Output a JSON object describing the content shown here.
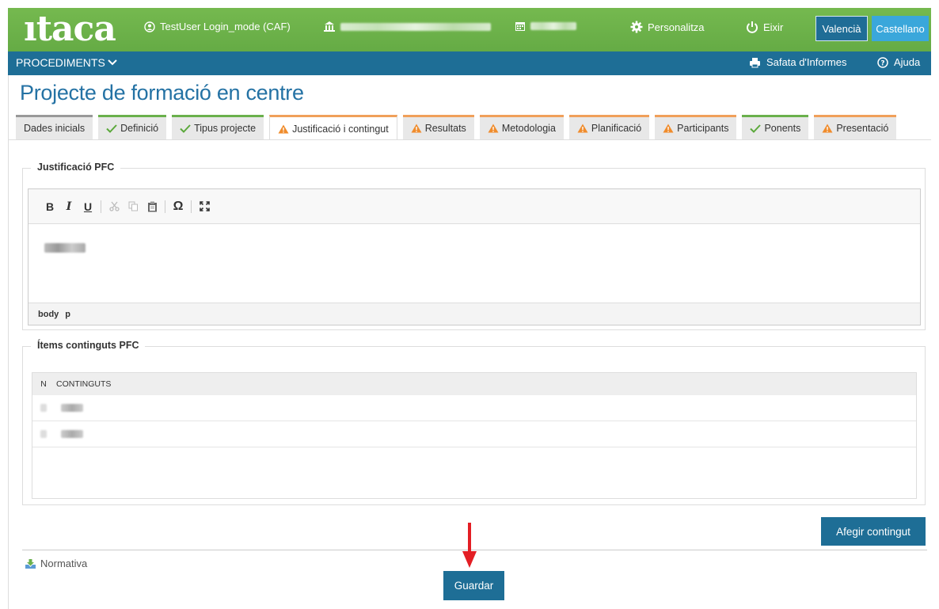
{
  "header": {
    "logo": "ıtaca",
    "user": "TestUser Login_mode (CAF)",
    "personalize": "Personalitza",
    "exit": "Eixir",
    "languages": [
      "Valencià",
      "Castellano"
    ],
    "colors": {
      "header_green": "#6ab04c",
      "nav_blue": "#1e6e96",
      "accent_blue": "#3aa7db",
      "warning_orange": "#f0a05a"
    }
  },
  "nav": {
    "procedures": "PROCEDIMENTS",
    "reports_tray": "Safata d'Informes",
    "help": "Ajuda"
  },
  "page": {
    "title": "Projecte de formació en centre"
  },
  "tabs": [
    {
      "label": "Dades inicials",
      "status": "none"
    },
    {
      "label": "Definició",
      "status": "ok"
    },
    {
      "label": "Tipus projecte",
      "status": "ok"
    },
    {
      "label": "Justificació i contingut",
      "status": "warning",
      "active": true
    },
    {
      "label": "Resultats",
      "status": "warning"
    },
    {
      "label": "Metodologia",
      "status": "warning"
    },
    {
      "label": "Planificació",
      "status": "warning"
    },
    {
      "label": "Participants",
      "status": "warning"
    },
    {
      "label": "Ponents",
      "status": "ok"
    },
    {
      "label": "Presentació",
      "status": "warning"
    }
  ],
  "justification": {
    "legend": "Justificació PFC",
    "toolbar": {
      "bold": "B",
      "italic": "I",
      "underline": "U",
      "special_char": "Ω"
    },
    "path": [
      "body",
      "p"
    ]
  },
  "contents": {
    "legend": "Ítems continguts PFC",
    "columns": [
      "N",
      "CONTINGUTS"
    ]
  },
  "buttons": {
    "add_content": "Afegir contingut",
    "save": "Guardar"
  },
  "footer": {
    "regulations": "Normativa"
  }
}
